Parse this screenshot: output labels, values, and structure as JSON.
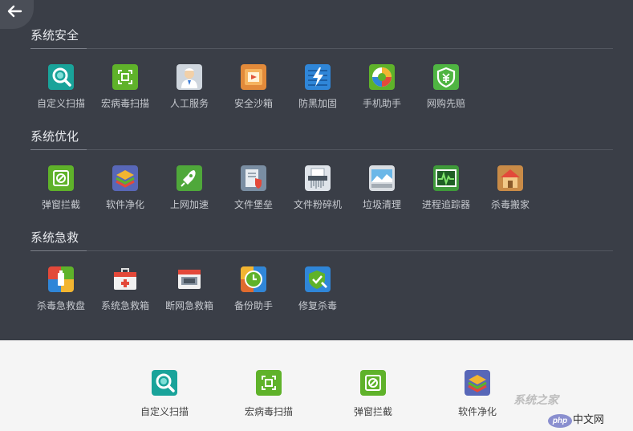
{
  "sections": [
    {
      "title": "系统安全",
      "items": [
        {
          "label": "自定义扫描",
          "icon": "custom-scan-icon"
        },
        {
          "label": "宏病毒扫描",
          "icon": "macro-virus-scan-icon"
        },
        {
          "label": "人工服务",
          "icon": "manual-service-icon"
        },
        {
          "label": "安全沙箱",
          "icon": "security-sandbox-icon"
        },
        {
          "label": "防黑加固",
          "icon": "anti-hack-hardening-icon"
        },
        {
          "label": "手机助手",
          "icon": "phone-assistant-icon"
        },
        {
          "label": "网购先赔",
          "icon": "shopping-compensation-icon"
        }
      ]
    },
    {
      "title": "系统优化",
      "items": [
        {
          "label": "弹窗拦截",
          "icon": "popup-block-icon"
        },
        {
          "label": "软件净化",
          "icon": "software-purify-icon"
        },
        {
          "label": "上网加速",
          "icon": "internet-boost-icon"
        },
        {
          "label": "文件堡垒",
          "icon": "file-fortress-icon"
        },
        {
          "label": "文件粉碎机",
          "icon": "file-shredder-icon"
        },
        {
          "label": "垃圾清理",
          "icon": "junk-cleanup-icon"
        },
        {
          "label": "进程追踪器",
          "icon": "process-tracker-icon"
        },
        {
          "label": "杀毒搬家",
          "icon": "antivirus-relocate-icon"
        }
      ]
    },
    {
      "title": "系统急救",
      "items": [
        {
          "label": "杀毒急救盘",
          "icon": "rescue-disk-icon"
        },
        {
          "label": "系统急救箱",
          "icon": "system-rescue-kit-icon"
        },
        {
          "label": "断网急救箱",
          "icon": "network-rescue-kit-icon"
        },
        {
          "label": "备份助手",
          "icon": "backup-assistant-icon"
        },
        {
          "label": "修复杀毒",
          "icon": "repair-antivirus-icon"
        }
      ]
    }
  ],
  "pinned": [
    {
      "label": "自定义扫描",
      "icon": "custom-scan-icon"
    },
    {
      "label": "宏病毒扫描",
      "icon": "macro-virus-scan-icon"
    },
    {
      "label": "弹窗拦截",
      "icon": "popup-block-icon"
    },
    {
      "label": "软件净化",
      "icon": "software-purify-icon"
    }
  ],
  "watermark": {
    "site1": "系统之家",
    "php_badge": "php",
    "site2": "中文网"
  },
  "colors": {
    "panel_bg": "#3a3e47",
    "bottom_bg": "#f5f5f5",
    "label_dark": "#c6c9cf",
    "green": "#5fb22a",
    "teal": "#19a39a"
  }
}
